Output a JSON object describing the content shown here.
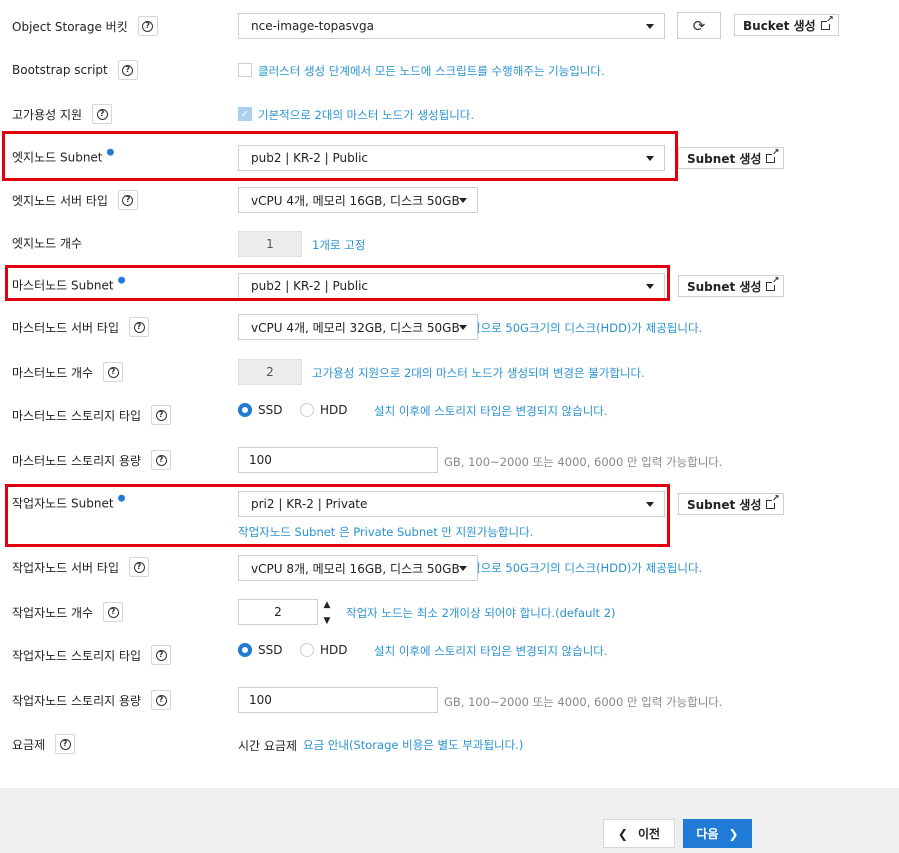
{
  "storage": {
    "label": "Object Storage 버킷",
    "value": "nce-image-topasvga",
    "bucket_button": "Bucket 생성"
  },
  "bootstrap": {
    "label": "Bootstrap script",
    "hint": "클러스터 생성 단계에서 모든 노드에 스크립트를 수행해주는 기능입니다."
  },
  "ha": {
    "label": "고가용성 지원",
    "hint": "기본적으로 2대의 마스터 노드가 생성됩니다."
  },
  "edge_subnet": {
    "label": "엣지노드 Subnet",
    "value": "pub2 | KR-2 | Public",
    "button": "Subnet 생성"
  },
  "edge_server": {
    "label": "엣지노드 서버 타입",
    "value": "vCPU 4개, 메모리 16GB, 디스크 50GB"
  },
  "edge_count": {
    "label": "엣지노드 개수",
    "value": "1",
    "hint": "1개로 고정"
  },
  "master_subnet": {
    "label": "마스터노드 Subnet",
    "value": "pub2 | KR-2 | Public",
    "button": "Subnet 생성"
  },
  "master_server": {
    "label": "마스터노드 서버 타입",
    "value": "vCPU 4개, 메모리 32GB, 디스크 50GB",
    "hint": "적으로 50G크기의 디스크(HDD)가 제공됩니다."
  },
  "master_count": {
    "label": "마스터노드 개수",
    "value": "2",
    "hint": "고가용성 지원으로 2대의 마스터 노드가 생성되며 변경은 불가합니다."
  },
  "master_storage_type": {
    "label": "마스터노드 스토리지 타입",
    "option_ssd": "SSD",
    "option_hdd": "HDD",
    "hint": "설치 이후에 스토리지 타입은 변경되지 않습니다."
  },
  "master_storage_size": {
    "label": "마스터노드 스토리지 용량",
    "value": "100",
    "hint": "GB, 100~2000 또는 4000, 6000 만 입력 가능합니다."
  },
  "worker_subnet": {
    "label": "작업자노드 Subnet",
    "value": "pri2 | KR-2 | Private",
    "button": "Subnet 생성",
    "hint": "작업자노드 Subnet 은 Private Subnet 만 지원가능합니다."
  },
  "worker_server": {
    "label": "작업자노드 서버 타입",
    "value": "vCPU 8개, 메모리 16GB, 디스크 50GB",
    "hint": "적으로 50G크기의 디스크(HDD)가 제공됩니다."
  },
  "worker_count": {
    "label": "작업자노드 개수",
    "value": "2",
    "hint": "작업자 노드는 최소 2개이상 되어야 합니다.(default 2)"
  },
  "worker_storage_type": {
    "label": "작업자노드 스토리지 타입",
    "option_ssd": "SSD",
    "option_hdd": "HDD",
    "hint": "설치 이후에 스토리지 타입은 변경되지 않습니다."
  },
  "worker_storage_size": {
    "label": "작업자노드 스토리지 용량",
    "value": "100",
    "hint": "GB, 100~2000 또는 4000, 6000 만 입력 가능합니다."
  },
  "pricing": {
    "label": "요금제",
    "value": "시간 요금제",
    "link": "요금 안내(Storage 비용은 별도 부과됩니다.)"
  },
  "footer": {
    "prev": "이전",
    "next": "다음"
  },
  "colors": {
    "accent": "#1f7bd6",
    "hint": "#2a92d1",
    "highlight": "#e0000f"
  }
}
